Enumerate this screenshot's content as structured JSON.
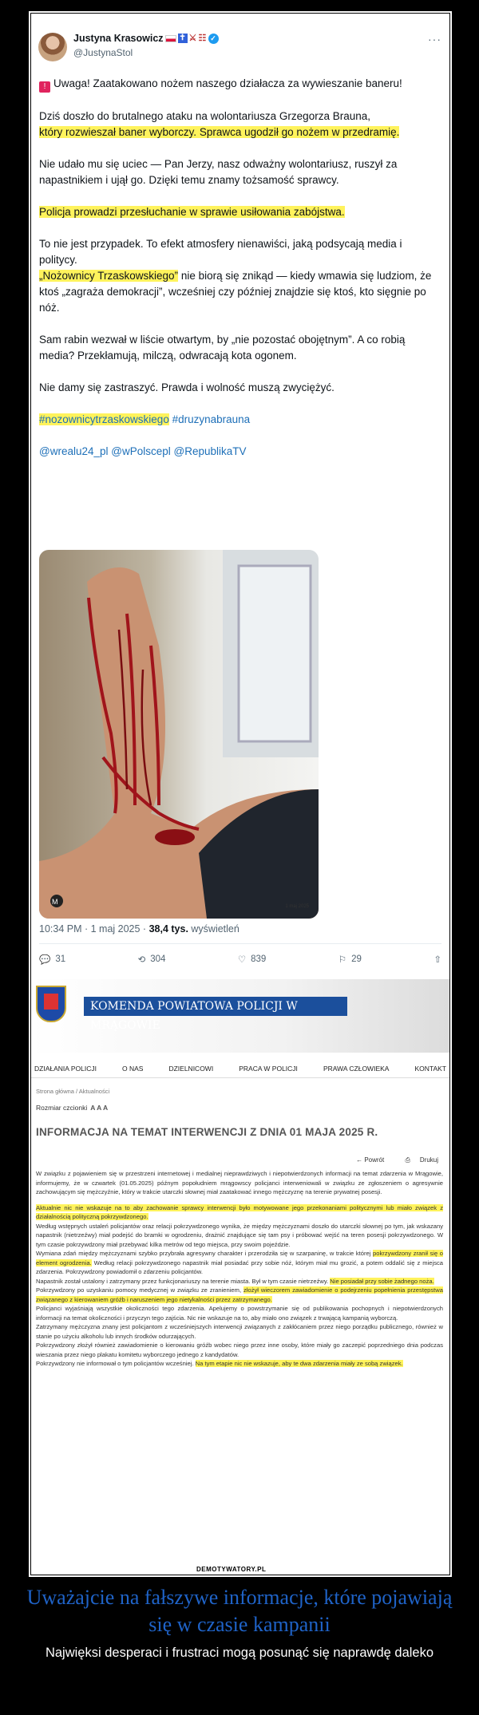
{
  "tweet": {
    "author_name": "Justyna Krasowicz",
    "handle": "@JustynaStol",
    "more_icon": "ellipsis-icon",
    "paragraphs": {
      "p1": "Uwaga! Zaatakowano nożem naszego działacza za wywieszanie baneru!",
      "p2a": "Dziś doszło do brutalnego ataku na wolontariusza Grzegorza Brauna,",
      "p2b": "który rozwieszał baner wyborczy. Sprawca ugodził go nożem w przedramię.",
      "p3": "Nie udało mu się uciec — Pan Jerzy, nasz odważny wolontariusz, ruszył za napastnikiem i ujął go. Dzięki temu znamy tożsamość sprawcy.",
      "p4": "Policja prowadzi przesłuchanie w sprawie usiłowania zabójstwa.",
      "p5a": "To nie jest przypadek. To efekt atmosfery nienawiści, jaką podsycają media i politycy.",
      "p5b": "„Nożownicy Trzaskowskiego”",
      "p5c": " nie biorą się znikąd — kiedy wmawia się ludziom, że ktoś „zagraża demokracji”, wcześniej czy później znajdzie się ktoś, kto sięgnie po nóż.",
      "p6": "Sam rabin wezwał w liście otwartym, by „nie pozostać obojętnym”. A co robią media? Przekłamują, milczą, odwracają kota ogonem.",
      "p7": "Nie damy się zastraszyć. Prawda i wolność muszą zwyciężyć.",
      "hashtag1": "#nozownicytrzaskowskiego",
      "hashtag2": " #druzynabrauna",
      "mentions": "@wrealu24_pl @wPolscepl @RepublikaTV"
    },
    "photo_caption_overlay": "1 maj 2025",
    "timestamp": "10:34 PM · 1 maj 2025 · ",
    "views": "38,4 tys.",
    "views_suffix": " wyświetleń",
    "actions": {
      "replies": "31",
      "reposts": "304",
      "likes": "839",
      "bookmarks": "29"
    }
  },
  "police": {
    "site_title": "KOMENDA POWIATOWA POLICJI W MRĄGOWIE",
    "nav": [
      "DZIAŁANIA POLICJI",
      "O NAS",
      "DZIELNICOWI",
      "PRACA W POLICJI",
      "PRAWA CZŁOWIEKA",
      "KONTAKT"
    ],
    "breadcrumb": "Strona główna / Aktualności",
    "font_size_label": "Rozmiar czcionki",
    "font_size_options": "A  A  A",
    "headline": "INFORMACJA NA TEMAT INTERWENCJI Z DNIA 01 MAJA 2025 R.",
    "back": "← Powrót",
    "print": "Drukuj",
    "p1": "W związku z pojawieniem się w przestrzeni internetowej i medialnej nieprawdziwych i niepotwierdzonych informacji na temat zdarzenia w Mrągowie, informujemy, że w czwartek (01.05.2025) późnym popołudniem mrągowscy policjanci interweniowali w związku ze zgłoszeniem o agresywnie zachowującym się mężczyźnie, który w trakcie utarczki słownej miał zaatakować innego mężczyznę na terenie prywatnej posesji.",
    "p2": "Aktualnie nic nie wskazuje na to aby zachowanie sprawcy interwencji było motywowane jego przekonaniami politycznymi lub miało związek z działalnością polityczną pokrzywdzonego.",
    "p3": "Według wstępnych ustaleń policjantów oraz relacji pokrzywdzonego wynika, że między mężczyznami doszło do utarczki słownej po tym, jak wskazany napastnik (nietrzeźwy) miał podejść do bramki w ogrodzeniu, drażnić znajdujące się tam psy i próbować wejść na teren posesji pokrzywdzonego. W tym czasie pokrzywdzony miał przebywać kilka metrów od tego miejsca, przy swoim pojeździe.",
    "p4a": "Wymiana zdań między mężczyznami szybko przybrała agresywny charakter i przerodziła się w szarpaninę, w trakcie której ",
    "p4b": "pokrzywdzony zranił się o element ogrodzenia.",
    "p4c": " Według relacji pokrzywdzonego napastnik miał posiadać przy sobie nóż, którym miał mu grozić, a potem oddalić się z miejsca zdarzenia. Pokrzywdzony powiadomił o zdarzeniu policjantów.",
    "p5a": "Napastnik został ustalony i zatrzymany przez funkcjonariuszy na terenie miasta. Był w tym czasie nietrzeźwy. ",
    "p5b": "Nie posiadał przy sobie żadnego noża.",
    "p6a": "Pokrzywdzony po uzyskaniu pomocy medycznej w związku ze zranieniem, ",
    "p6b": "złożył wieczorem zawiadomienie o podejrzeniu popełnienia przestępstwa związanego z kierowaniem gróźb i naruszeniem jego nietykalności przez zatrzymanego.",
    "p7": "Policjanci wyjaśniają wszystkie okoliczności tego zdarzenia. Apelujemy o powstrzymanie się od publikowania pochopnych i niepotwierdzonych informacji na temat okoliczności i przyczyn tego zajścia. Nic nie wskazuje na to, aby miało ono związek z trwającą kampanią wyborczą.",
    "p8": "Zatrzymany mężczyzna znany jest policjantom z wcześniejszych interwencji związanych z zakłócaniem przez niego porządku publicznego, również w stanie po użyciu alkoholu lub innych środków odurzających.",
    "p9": "Pokrzywdzony złożył również zawiadomienie o kierowaniu gróźb wobec niego przez inne osoby, które miały go zaczepić poprzedniego dnia podczas wieszania przez niego plakatu komitetu wyborczego jednego z kandydatów.",
    "p10a": "Pokrzywdzony nie informował o tym policjantów wcześniej. ",
    "p10b": "Na tym etapie nic nie wskazuje, aby te dwa zdarzenia miały ze sobą związek."
  },
  "watermark": "DEMOTYWATORY.PL",
  "title": "Uważajcie na fałszywe informacje, które pojawiają się w czasie kampanii",
  "subtitle": "Najwięksi desperaci i frustraci mogą posunąć się naprawdę daleko"
}
